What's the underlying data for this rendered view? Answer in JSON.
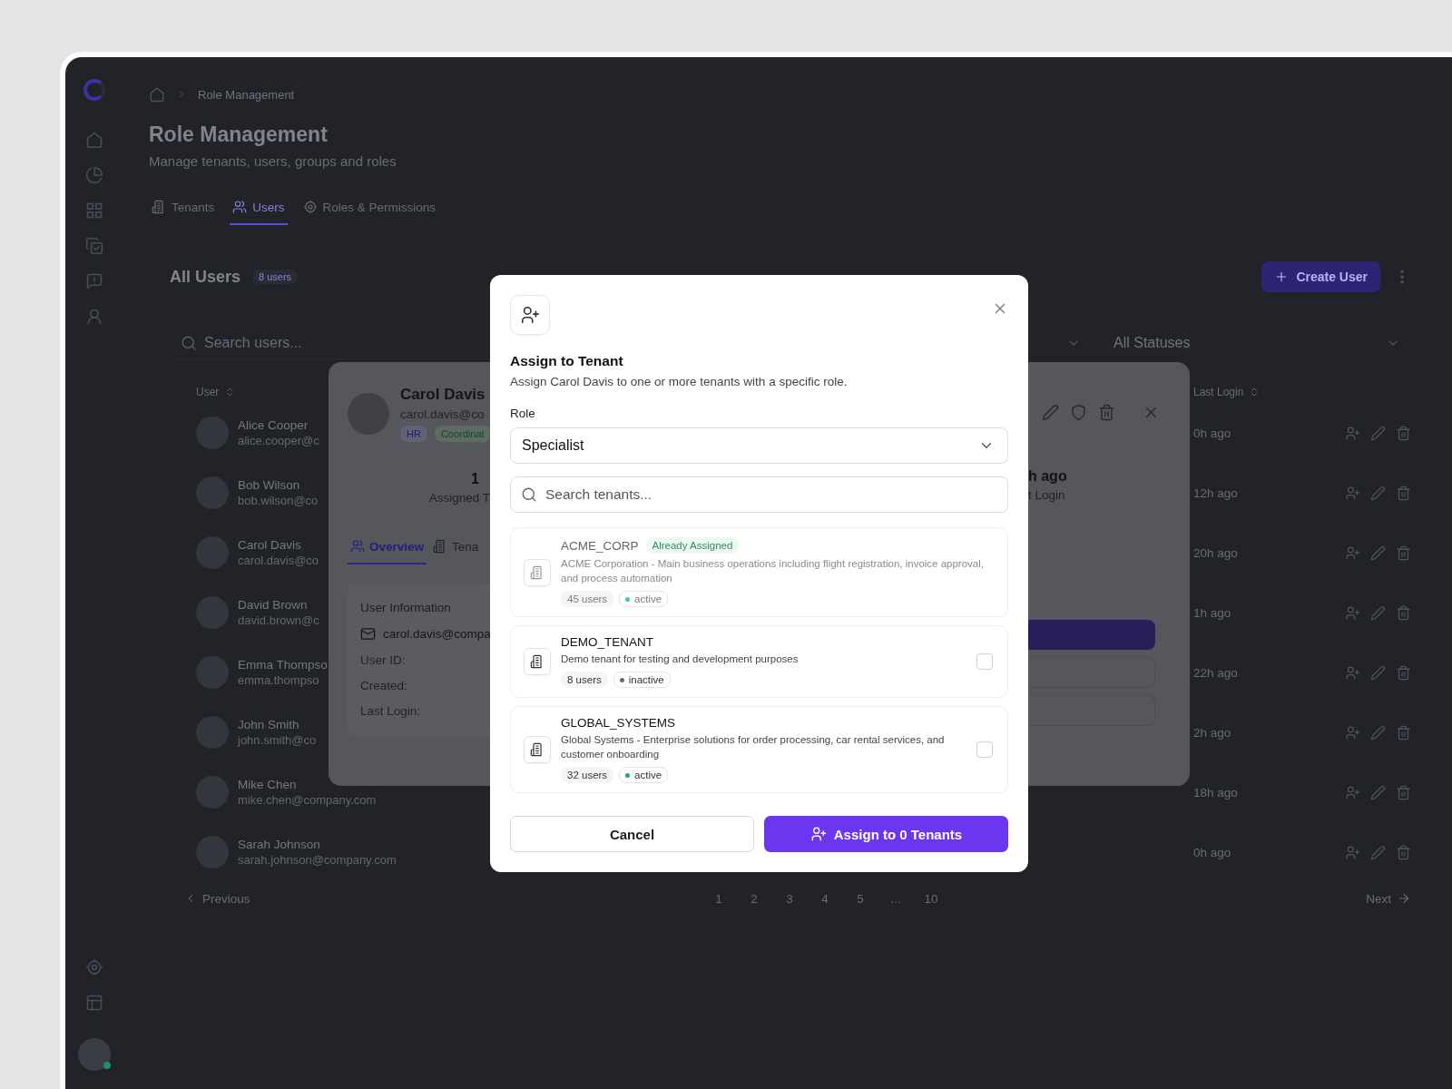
{
  "breadcrumb": {
    "current": "Role Management"
  },
  "page": {
    "title": "Role Management",
    "subtitle": "Manage tenants, users, groups and roles"
  },
  "tabs": [
    {
      "label": "Tenants",
      "selected": false
    },
    {
      "label": "Users",
      "selected": true
    },
    {
      "label": "Roles & Permissions",
      "selected": false
    }
  ],
  "users_card": {
    "title": "All Users",
    "count": "8 users",
    "create_button": "Create User",
    "search_placeholder": "Search users...",
    "status_filter": "All Statuses"
  },
  "table": {
    "columns": [
      "User",
      "Last Login"
    ],
    "rows": [
      {
        "name": "Alice Cooper",
        "email": "alice.cooper@c",
        "last_login": "0h ago"
      },
      {
        "name": "Bob Wilson",
        "email": "bob.wilson@co",
        "last_login": "12h ago"
      },
      {
        "name": "Carol Davis",
        "email": "carol.davis@co",
        "last_login": "20h ago"
      },
      {
        "name": "David Brown",
        "email": "david.brown@c",
        "last_login": "1h ago"
      },
      {
        "name": "Emma Thompso",
        "email": "emma.thompso",
        "last_login": "22h ago"
      },
      {
        "name": "John Smith",
        "email": "john.smith@co",
        "last_login": "2h ago"
      },
      {
        "name": "Mike Chen",
        "email": "mike.chen@company.com",
        "last_login": "18h ago"
      },
      {
        "name": "Sarah Johnson",
        "email": "sarah.johnson@company.com",
        "last_login": "0h ago"
      }
    ]
  },
  "pagination": {
    "previous": "Previous",
    "pages": [
      "1",
      "2",
      "3",
      "4",
      "5",
      "...",
      "10"
    ],
    "next": "Next"
  },
  "user_panel": {
    "name": "Carol Davis",
    "email": "carol.davis@co",
    "tags": [
      {
        "label": "HR",
        "kind": "department"
      },
      {
        "label": "Coordinat",
        "kind": "role"
      }
    ],
    "stat_left": {
      "value": "1",
      "label": "Assigned T"
    },
    "stat_right": {
      "value": "h ago",
      "label": "t Login"
    },
    "tabs": [
      {
        "label": "Overview",
        "selected": true
      },
      {
        "label": "Tena",
        "selected": false
      }
    ],
    "info": {
      "title": "User Information",
      "email": "carol.davis@compa",
      "fields": [
        "User ID:",
        "Created:",
        "Last Login:"
      ]
    }
  },
  "modal": {
    "title": "Assign to Tenant",
    "description": "Assign Carol Davis to one or more tenants with a specific role.",
    "role_label": "Role",
    "role_value": "Specialist",
    "search_placeholder": "Search tenants...",
    "tenants": [
      {
        "name": "ACME_CORP",
        "assigned": true,
        "badge": "Already Assigned",
        "description": "ACME Corporation - Main business operations including flight registration, invoice approval, and process automation",
        "users": "45 users",
        "status": "active",
        "color": "#3ecf8e"
      },
      {
        "name": "DEMO_TENANT",
        "assigned": false,
        "checked": false,
        "description": "Demo tenant for testing and development purposes",
        "users": "8 users",
        "status": "inactive",
        "color": "#6b6b6b"
      },
      {
        "name": "GLOBAL_SYSTEMS",
        "assigned": false,
        "checked": false,
        "description": "Global Systems - Enterprise solutions for order processing, car rental services, and customer onboarding",
        "users": "32 users",
        "status": "active",
        "color": "#16b364"
      }
    ],
    "cancel": "Cancel",
    "submit": "Assign to 0 Tenants"
  }
}
